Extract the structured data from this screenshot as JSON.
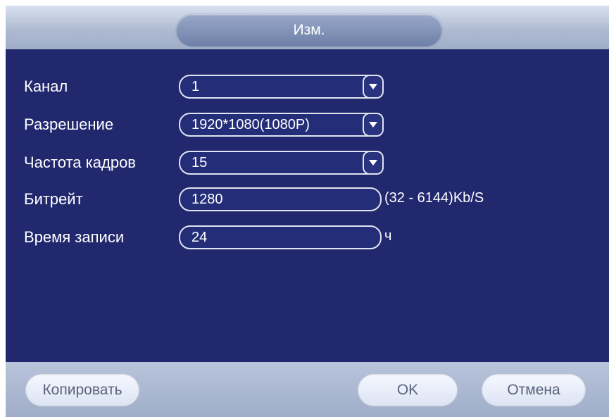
{
  "dialog": {
    "title": "Изм."
  },
  "fields": {
    "channel": {
      "label": "Канал",
      "value": "1"
    },
    "resolution": {
      "label": "Разрешение",
      "value": "1920*1080(1080P)"
    },
    "frame_rate": {
      "label": "Частота кадров",
      "value": "15"
    },
    "bitrate": {
      "label": "Битрейт",
      "value": "1280",
      "suffix": "(32 - 6144)Kb/S"
    },
    "record_time": {
      "label": "Время записи",
      "value": "24",
      "suffix": "ч"
    }
  },
  "buttons": {
    "copy": "Копировать",
    "ok": "OK",
    "cancel": "Отмена"
  },
  "colors": {
    "panel": "#21286e",
    "header": "#aebbd2",
    "button": "#e8edf8"
  },
  "icons": {
    "dropdown": "chevron-down-icon"
  }
}
